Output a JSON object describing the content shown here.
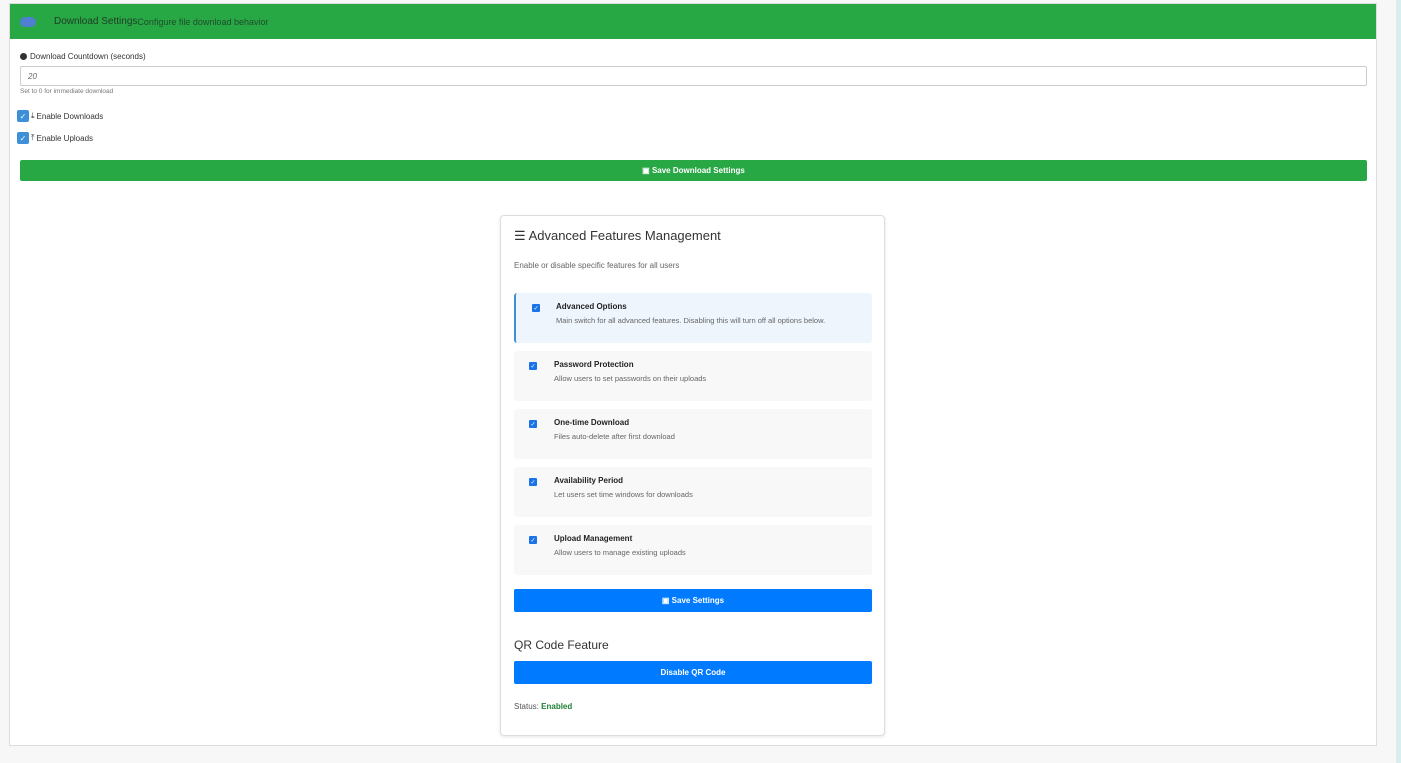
{
  "header": {
    "title": "Download Settings",
    "subtitle": "Configure file download behavior"
  },
  "countdown": {
    "label": "Download Countdown (seconds)",
    "value": "20",
    "help": "Set to 0 for immediate download"
  },
  "checks": [
    {
      "label": "Enable Downloads",
      "checked": true
    },
    {
      "label": "Enable Uploads",
      "checked": true
    }
  ],
  "save_download": "Save Download Settings",
  "advanced": {
    "title": "Advanced Features Management",
    "subtitle": "Enable or disable specific features for all users",
    "items": [
      {
        "name": "Advanced Options",
        "desc": "Main switch for all advanced features. Disabling this will turn off all options below.",
        "checked": true
      },
      {
        "name": "Password Protection",
        "desc": "Allow users to set passwords on their uploads",
        "checked": true
      },
      {
        "name": "One-time Download",
        "desc": "Files auto-delete after first download",
        "checked": true
      },
      {
        "name": "Availability Period",
        "desc": "Let users set time windows for downloads",
        "checked": true
      },
      {
        "name": "Upload Management",
        "desc": "Allow users to manage existing uploads",
        "checked": true
      }
    ],
    "save": "Save Settings"
  },
  "qr": {
    "title": "QR Code Feature",
    "button": "Disable QR Code",
    "status_label": "Status:",
    "status": "Enabled"
  }
}
